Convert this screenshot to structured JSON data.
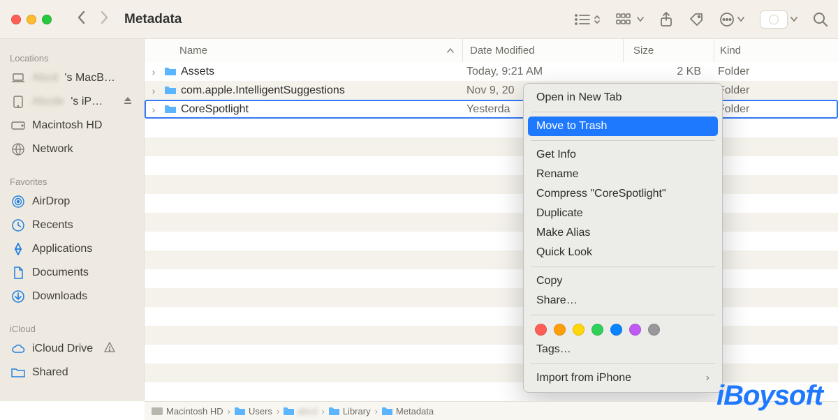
{
  "window": {
    "title": "Metadata"
  },
  "toolbar": {
    "back": "chevron-left",
    "forward": "chevron-right"
  },
  "sidebar": {
    "sections": {
      "locations": "Locations",
      "favorites": "Favorites",
      "icloud": "iCloud"
    },
    "locations": [
      {
        "icon": "laptop",
        "label": "'s MacB…"
      },
      {
        "icon": "ipad",
        "label": "'s iP…",
        "eject": true
      },
      {
        "icon": "drive",
        "label": "Macintosh HD"
      },
      {
        "icon": "globe",
        "label": "Network"
      }
    ],
    "favorites": [
      {
        "icon": "airdrop",
        "label": "AirDrop"
      },
      {
        "icon": "clock",
        "label": "Recents"
      },
      {
        "icon": "apps",
        "label": "Applications"
      },
      {
        "icon": "doc",
        "label": "Documents"
      },
      {
        "icon": "download",
        "label": "Downloads"
      }
    ],
    "icloud": [
      {
        "icon": "cloud",
        "label": "iCloud Drive",
        "warn": true
      },
      {
        "icon": "sharefolder",
        "label": "Shared"
      }
    ]
  },
  "columns": {
    "name": "Name",
    "date": "Date Modified",
    "size": "Size",
    "kind": "Kind"
  },
  "rows": [
    {
      "name": "Assets",
      "date": "Today, 9:21 AM",
      "size": "2 KB",
      "kind": "Folder",
      "selected": false
    },
    {
      "name": "com.apple.IntelligentSuggestions",
      "date": "Nov 9, 20",
      "size": "",
      "kind": "Folder",
      "selected": false
    },
    {
      "name": "CoreSpotlight",
      "date": "Yesterda",
      "size": "",
      "kind": "Folder",
      "selected": true
    }
  ],
  "context_menu": {
    "items_top": [
      "Open in New Tab"
    ],
    "highlighted": "Move to Trash",
    "items_mid": [
      "Get Info",
      "Rename",
      "Compress \"CoreSpotlight\"",
      "Duplicate",
      "Make Alias",
      "Quick Look"
    ],
    "items_copy": [
      "Copy",
      "Share…"
    ],
    "tag_colors": [
      "#ff5f57",
      "#ff9f0a",
      "#ffd60a",
      "#30d158",
      "#0a84ff",
      "#bf5af2",
      "#98989d"
    ],
    "tags_label": "Tags…",
    "import_label": "Import from iPhone"
  },
  "pathbar": [
    {
      "icon": "drive",
      "label": "Macintosh HD"
    },
    {
      "icon": "folder",
      "label": "Users"
    },
    {
      "icon": "folder",
      "label": ""
    },
    {
      "icon": "folder",
      "label": "Library"
    },
    {
      "icon": "folder",
      "label": "Metadata"
    }
  ],
  "watermark": "iBoysoft"
}
